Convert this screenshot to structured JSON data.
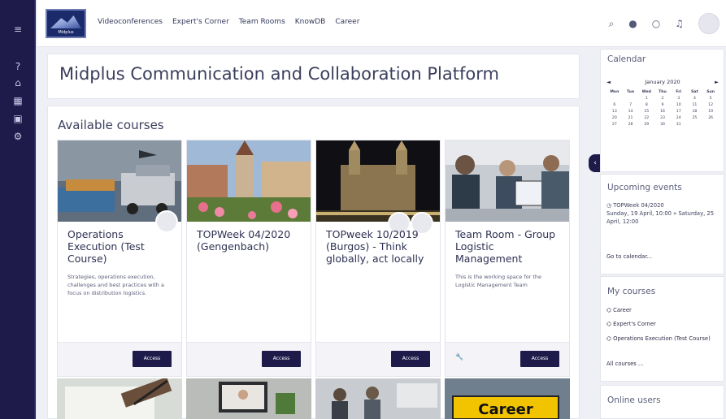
{
  "rail": {
    "icons": [
      "menu-icon",
      "help-icon",
      "home-icon",
      "calendar-icon",
      "files-icon",
      "settings-icon"
    ]
  },
  "header": {
    "logo_text": "Midplus",
    "nav": [
      "Videoconferences",
      "Expert's Corner",
      "Team Rooms",
      "KnowDB",
      "Career"
    ],
    "icons": [
      "search-icon",
      "globe-icon",
      "chat-icon",
      "bell-icon",
      "avatar"
    ]
  },
  "main": {
    "title": "Midplus Communication and Collaboration Platform",
    "section_title": "Available courses",
    "courses": [
      {
        "title": "Operations Execution (Test Course)",
        "description": "Strategies, operations execution, challenges and best practices with a focus on distribution logistics.",
        "button": "Access"
      },
      {
        "title": "TOPWeek 04/2020 (Gengenbach)",
        "description": "",
        "button": "Access"
      },
      {
        "title": "TOPweek 10/2019 (Burgos) - Think globally, act locally",
        "description": "",
        "button": "Access"
      },
      {
        "title": "Team Room - Group Logistic Management",
        "description": "This is the working space for the Logistic Management Team",
        "button": "Access"
      }
    ],
    "bottom_tile_label": "Career"
  },
  "sidebar": {
    "calendar": {
      "title": "Calendar",
      "month": "January 2020",
      "prev": "◄",
      "next": "►",
      "day_names": [
        "Mon",
        "Tue",
        "Wed",
        "Thu",
        "Fri",
        "Sat",
        "Sun"
      ],
      "days": [
        "",
        "",
        "1",
        "2",
        "3",
        "4",
        "5",
        "6",
        "7",
        "8",
        "9",
        "10",
        "11",
        "12",
        "13",
        "14",
        "15",
        "16",
        "17",
        "18",
        "19",
        "20",
        "21",
        "22",
        "23",
        "24",
        "25",
        "26",
        "27",
        "28",
        "29",
        "30",
        "31",
        "",
        ""
      ]
    },
    "upcoming": {
      "title": "Upcoming events",
      "event_name": "TOPWeek 04/2020",
      "event_dates": "Sunday, 19 April, 10:00 » Saturday, 25 April, 12:00",
      "link": "Go to calendar..."
    },
    "my_courses": {
      "title": "My courses",
      "items": [
        "Career",
        "Expert's Corner",
        "Operations Execution (Test Course)"
      ],
      "all_link": "All courses ..."
    },
    "online_users": {
      "title": "Online users"
    }
  },
  "colors": {
    "brand_dark": "#1e1b4b",
    "background": "#eef0f5",
    "text": "#2d2d4a"
  }
}
